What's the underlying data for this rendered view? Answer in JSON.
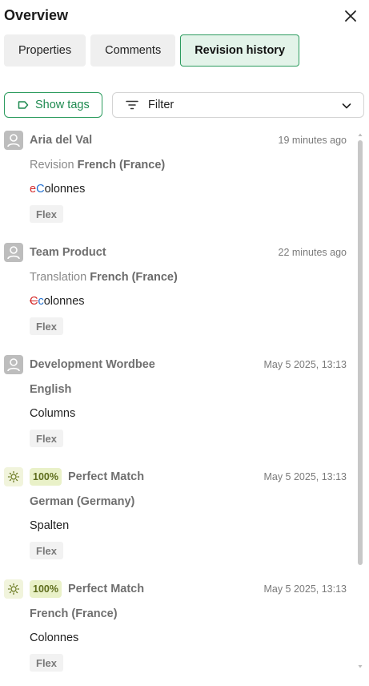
{
  "header": {
    "title": "Overview"
  },
  "tabs": [
    {
      "label": "Properties"
    },
    {
      "label": "Comments"
    },
    {
      "label": "Revision history"
    }
  ],
  "toolbar": {
    "show_tags_label": "Show tags",
    "filter_label": "Filter"
  },
  "entries": [
    {
      "author": "Aria del Val",
      "time": "19 minutes ago",
      "action": "Revision",
      "language": "French (France)",
      "content": {
        "deleted": "e",
        "inserted": "C",
        "rest": "olonnes"
      },
      "tag": "Flex"
    },
    {
      "author": "Team Product",
      "time": "22 minutes ago",
      "action": "Translation",
      "language": "French (France)",
      "content": {
        "deleted": "C",
        "inserted": "c",
        "rest": "olonnes"
      },
      "tag": "Flex"
    },
    {
      "author": "Development Wordbee",
      "time": "May 5 2025, 13:13",
      "language": "English",
      "content_text": "Columns",
      "tag": "Flex"
    },
    {
      "badge": "100%",
      "match": "Perfect Match",
      "time": "May 5 2025, 13:13",
      "language": "German (Germany)",
      "content_text": "Spalten",
      "tag": "Flex"
    },
    {
      "badge": "100%",
      "match": "Perfect Match",
      "time": "May 5 2025, 13:13",
      "language": "French (France)",
      "content_text": "Colonnes",
      "tag": "Flex"
    }
  ],
  "colors": {
    "accent": "#2d9c5f",
    "inserted": "#1f6fd1",
    "deleted": "#d42a2a",
    "badge_bg": "#e9f1c8"
  },
  "icons": [
    "close-icon",
    "tag-icon",
    "filter-icon",
    "chevron-down-icon",
    "user-avatar-icon",
    "sun-match-icon"
  ]
}
